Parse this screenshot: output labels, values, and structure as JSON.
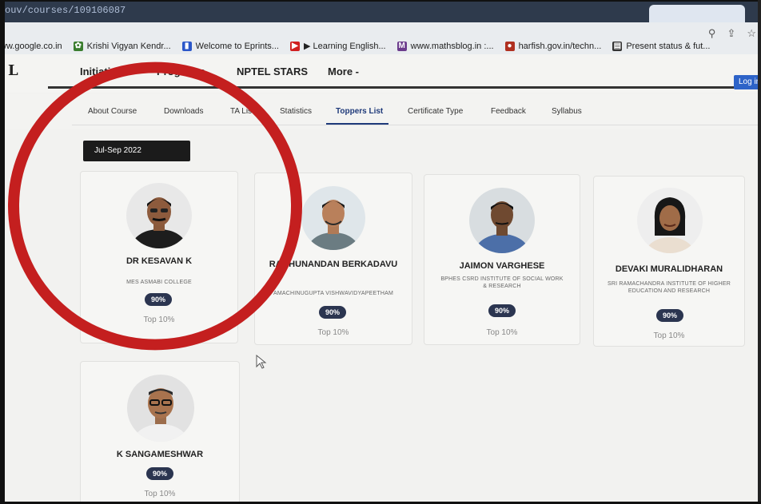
{
  "browser": {
    "url": "ouv/courses/109106087",
    "bookmarks": [
      {
        "label": "ww.google.co.in",
        "icon": "google-icon",
        "color": "#e9ecef"
      },
      {
        "label": "Krishi Vigyan Kendr...",
        "icon": "kvk-icon",
        "color": "#3a7d2e"
      },
      {
        "label": "Welcome to Eprints...",
        "icon": "document-icon",
        "color": "#2b57c9"
      },
      {
        "label": "▶ Learning English...",
        "icon": "youtube-icon",
        "color": "#d02020"
      },
      {
        "label": "www.mathsblog.in :...",
        "icon": "mathsblog-icon",
        "color": "#6b3b8c"
      },
      {
        "label": "harfish.gov.in/techn...",
        "icon": "fish-icon",
        "color": "#b03020"
      },
      {
        "label": "Present status & fut...",
        "icon": "page-icon",
        "color": "#333333"
      }
    ]
  },
  "nav": {
    "logo": "L",
    "items": [
      "Initiatives -",
      "Programs",
      "NPTEL STARS",
      "More -"
    ],
    "login": "Log in"
  },
  "course_tabs": {
    "items": [
      "About Course",
      "Downloads",
      "TA List",
      "Statistics",
      "Toppers List",
      "Certificate Type",
      "Feedback",
      "Syllabus"
    ],
    "active": "Toppers List"
  },
  "session": "Jul-Sep 2022",
  "toppers": [
    {
      "name": "DR KESAVAN K",
      "college": "MES ASMABI COLLEGE",
      "score": "90%",
      "rank": "Top 10%"
    },
    {
      "name": "RAGHUNANDAN BERKADAVU",
      "college": "AMACHINUGUPTA VISHWAVIDYAPEETHAM",
      "score": "90%",
      "rank": "Top 10%"
    },
    {
      "name": "JAIMON VARGHESE",
      "college": "BPHES CSRD INSTITUTE OF SOCIAL WORK & RESEARCH",
      "score": "90%",
      "rank": "Top 10%"
    },
    {
      "name": "DEVAKI MURALIDHARAN",
      "college": "SRI RAMACHANDRA INSTITUTE OF HIGHER EDUCATION AND RESEARCH",
      "score": "90%",
      "rank": "Top 10%"
    },
    {
      "name": "K SANGAMESHWAR",
      "college": "",
      "score": "90%",
      "rank": "Top 10%"
    }
  ],
  "colors": {
    "accent": "#1f3a7a",
    "badge": "#2b3550",
    "annotation": "#c41f1f",
    "login": "#2d63c8"
  }
}
